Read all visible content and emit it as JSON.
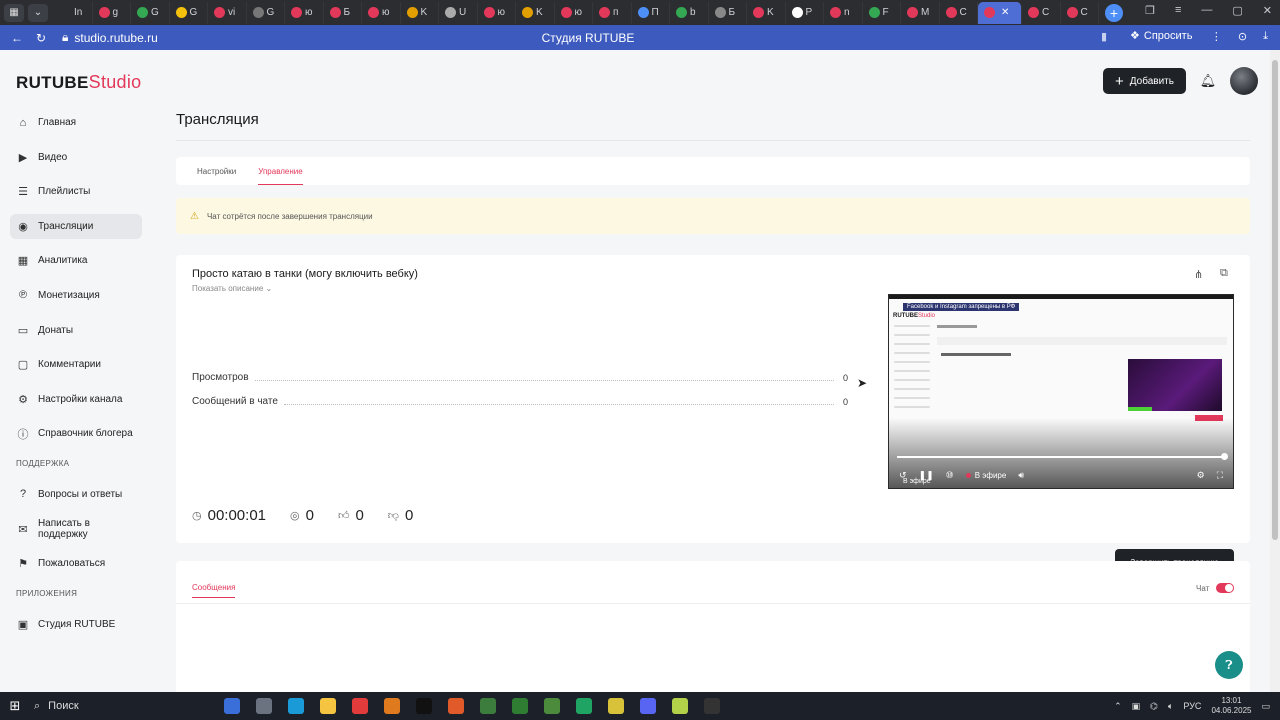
{
  "browser": {
    "tabs": [
      {
        "label": "In",
        "color": "#2b2d31"
      },
      {
        "label": "g",
        "color": "#e2385a"
      },
      {
        "label": "G",
        "color": "#34a853"
      },
      {
        "label": "G",
        "color": "#f4c20d"
      },
      {
        "label": "vi",
        "color": "#e2385a"
      },
      {
        "label": "G",
        "color": "#777"
      },
      {
        "label": "ю",
        "color": "#e2385a"
      },
      {
        "label": "Б",
        "color": "#e2385a"
      },
      {
        "label": "ю",
        "color": "#e2385a"
      },
      {
        "label": "K",
        "color": "#e2a000"
      },
      {
        "label": "U",
        "color": "#aaa"
      },
      {
        "label": "ю",
        "color": "#e2385a"
      },
      {
        "label": "K",
        "color": "#e2a000"
      },
      {
        "label": "ю",
        "color": "#e2385a"
      },
      {
        "label": "п",
        "color": "#e2385a"
      },
      {
        "label": "П",
        "color": "#4e8ff7"
      },
      {
        "label": "b",
        "color": "#34a853"
      },
      {
        "label": "Б",
        "color": "#888"
      },
      {
        "label": "K",
        "color": "#e2385a"
      },
      {
        "label": "P",
        "color": "#fff"
      },
      {
        "label": "n",
        "color": "#e2385a"
      },
      {
        "label": "F",
        "color": "#34a853"
      },
      {
        "label": "M",
        "color": "#e2385a"
      },
      {
        "label": "C",
        "color": "#e2385a"
      },
      {
        "label": "",
        "color": "#e2385a",
        "active": true
      },
      {
        "label": "C",
        "color": "#e2385a"
      },
      {
        "label": "C",
        "color": "#e2385a"
      }
    ],
    "url": "studio.rutube.ru",
    "page_title": "Студия RUTUBE",
    "ask_label": "Спросить"
  },
  "brand": {
    "logo_main": "RUTUBE",
    "logo_studio": "Studio"
  },
  "header": {
    "add_label": "Добавить"
  },
  "sidebar": {
    "items": [
      {
        "label": "Главная",
        "icon": "home-icon",
        "glyph": "⌂"
      },
      {
        "label": "Видео",
        "icon": "video-icon",
        "glyph": "▶"
      },
      {
        "label": "Плейлисты",
        "icon": "playlist-icon",
        "glyph": "☰"
      },
      {
        "label": "Трансляции",
        "icon": "broadcast-icon",
        "glyph": "◉",
        "active": true
      },
      {
        "label": "Аналитика",
        "icon": "analytics-icon",
        "glyph": "▦"
      },
      {
        "label": "Монетизация",
        "icon": "monetization-icon",
        "glyph": "℗"
      },
      {
        "label": "Донаты",
        "icon": "donate-icon",
        "glyph": "▭"
      },
      {
        "label": "Комментарии",
        "icon": "comments-icon",
        "glyph": "▢"
      },
      {
        "label": "Настройки канала",
        "icon": "settings-icon",
        "glyph": "⚙"
      },
      {
        "label": "Справочник блогера",
        "icon": "help-icon",
        "glyph": "ⓘ"
      }
    ],
    "support_section": "ПОДДЕРЖКА",
    "support_items": [
      {
        "label": "Вопросы и ответы",
        "icon": "faq-icon",
        "glyph": "?"
      },
      {
        "label": "Написать в поддержку",
        "icon": "mail-icon",
        "glyph": "✉"
      },
      {
        "label": "Пожаловаться",
        "icon": "flag-icon",
        "glyph": "⚑"
      }
    ],
    "apps_section": "ПРИЛОЖЕНИЯ",
    "apps_items": [
      {
        "label": "Студия RUTUBE",
        "icon": "studio-app-icon",
        "glyph": "▣"
      }
    ]
  },
  "main": {
    "title": "Трансляция",
    "tabs": [
      {
        "label": "Настройки",
        "active": false
      },
      {
        "label": "Управление",
        "active": true
      }
    ],
    "warning": "Чат сотрётся после завершения трансляции",
    "stream": {
      "title": "Просто катаю в танки (могу включить вебку)",
      "show_description": "Показать описание",
      "stats": [
        {
          "label": "Просмотров",
          "value": "0"
        },
        {
          "label": "Сообщений в чате",
          "value": "0"
        }
      ],
      "duration": "00:00:01",
      "viewers": "0",
      "likes": "0",
      "dislikes": "0",
      "end_button": "Завершить трансляцию",
      "player": {
        "badge": "Facebook и Instagram запрещены в РФ",
        "live_label": "В эфире",
        "live_label_corner": "В эфире",
        "progress": 1.0
      }
    },
    "messages": {
      "tab_label": "Сообщения",
      "chat_label": "Чат",
      "chat_enabled": true
    }
  },
  "taskbar": {
    "search_label": "Поиск",
    "lang": "РУС",
    "time": "13:01",
    "date": "04.06.2025"
  }
}
